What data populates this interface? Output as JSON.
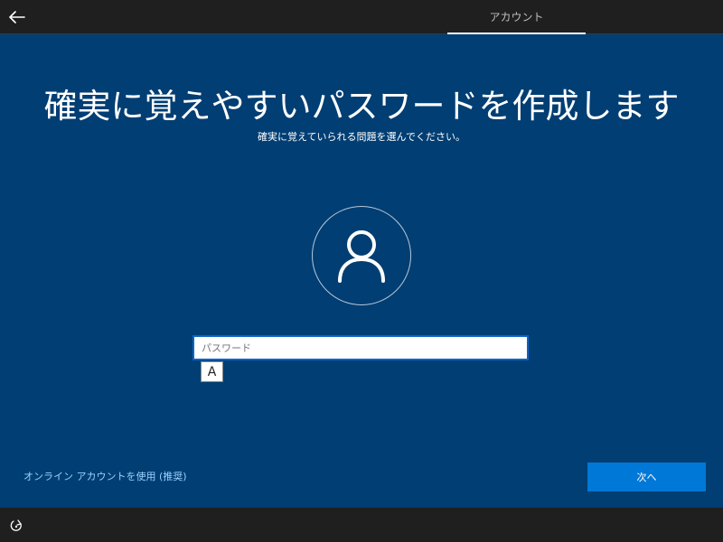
{
  "header": {
    "back_icon": "arrow-left-icon",
    "active_tab": "アカウント"
  },
  "main": {
    "title": "確実に覚えやすいパスワードを作成します",
    "subtitle": "確実に覚えていられる問題を選んでください。",
    "avatar_icon": "user-icon",
    "password_placeholder": "パスワード",
    "ime_mode": "A",
    "online_account_link": "オンライン アカウントを使用 (推奨)",
    "next_button": "次へ"
  },
  "footer": {
    "accessibility_icon": "ease-of-access-icon"
  },
  "colors": {
    "background": "#003e73",
    "bar": "#1f1f1f",
    "accent": "#0078d7",
    "link": "#9cd3ff"
  }
}
